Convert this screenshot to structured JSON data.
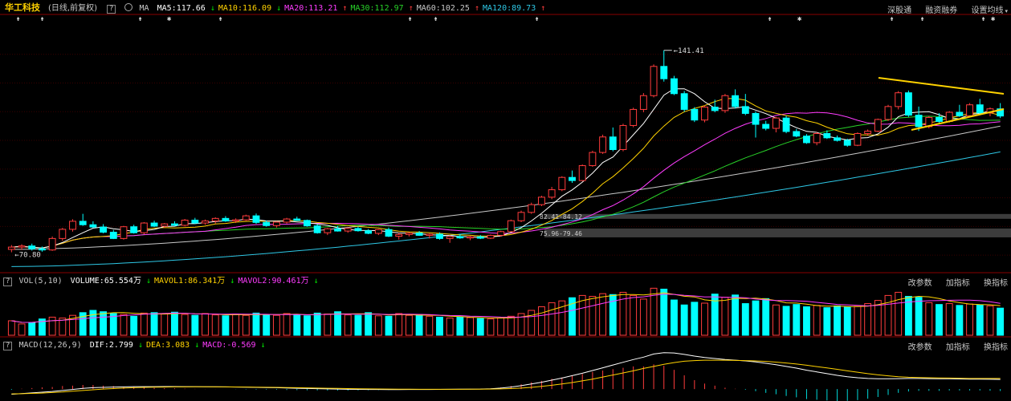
{
  "header": {
    "stock_name": "华工科技",
    "period": "(日线,前复权)",
    "help": "?",
    "ma_label": "MA",
    "ma_items": [
      {
        "text": "MA5:117.66",
        "arrow": "↓",
        "color": "#ffffff"
      },
      {
        "text": "MA10:116.09",
        "arrow": "↓",
        "color": "#ffd200"
      },
      {
        "text": "MA20:113.21",
        "arrow": "↑",
        "color": "#ff3cff"
      },
      {
        "text": "MA30:112.97",
        "arrow": "↑",
        "color": "#28d228"
      },
      {
        "text": "MA60:102.25",
        "arrow": "↑",
        "color": "#c8c8c8"
      },
      {
        "text": "MA120:89.73",
        "arrow": "↑",
        "color": "#2ec8e6"
      }
    ],
    "right_links": [
      "深股通",
      "融资融券",
      "设置均线"
    ]
  },
  "marks": [
    {
      "x": 20,
      "s": "⇟"
    },
    {
      "x": 50,
      "s": "⇟"
    },
    {
      "x": 172,
      "s": "⇟"
    },
    {
      "x": 208,
      "s": "✱"
    },
    {
      "x": 272,
      "s": "⇟"
    },
    {
      "x": 508,
      "s": "⇟"
    },
    {
      "x": 540,
      "s": "⇟"
    },
    {
      "x": 666,
      "s": "⇟"
    },
    {
      "x": 956,
      "s": "⇟"
    },
    {
      "x": 993,
      "s": "✱"
    },
    {
      "x": 1108,
      "s": "⇟"
    },
    {
      "x": 1146,
      "s": "⇟"
    },
    {
      "x": 1222,
      "s": "⇟"
    },
    {
      "x": 1234,
      "s": "✱"
    }
  ],
  "annotations": {
    "high": "141.41",
    "low": "70.80",
    "band_upper": "82.41-84.12",
    "band_lower": "75.96-79.46"
  },
  "vol_panel": {
    "help": "?",
    "name": "VOL(5,10)",
    "items": [
      {
        "text": "VOLUME:65.554万",
        "arrow": "↓",
        "color": "#ffffff"
      },
      {
        "text": "MAVOL1:86.341万",
        "arrow": "↓",
        "color": "#ffd200"
      },
      {
        "text": "MAVOL2:90.461万",
        "arrow": "↓",
        "color": "#ff3cff"
      }
    ],
    "links": [
      "改参数",
      "加指标",
      "换指标"
    ]
  },
  "macd_panel": {
    "help": "?",
    "name": "MACD(12,26,9)",
    "items": [
      {
        "text": "DIF:2.799",
        "arrow": "↓",
        "color": "#ffffff"
      },
      {
        "text": "DEA:3.083",
        "arrow": "↓",
        "color": "#ffd200"
      },
      {
        "text": "MACD:-0.569",
        "arrow": "↓",
        "color": "#ff3cff"
      }
    ],
    "links": [
      "改参数",
      "加指标",
      "换指标"
    ]
  },
  "colors": {
    "up": "#ff3c3c",
    "down": "#00ffff",
    "ma5": "#ffffff",
    "ma10": "#ffd200",
    "ma20": "#ff3cff",
    "ma30": "#28d228",
    "ma60": "#c8c8c8",
    "ma120": "#2ec8e6",
    "trendline": "#ffd200"
  },
  "chart_data": {
    "type": "candlestick",
    "ylim": [
      65,
      150
    ],
    "ohlc": [
      [
        72,
        73.5,
        71,
        72.8
      ],
      [
        72.8,
        73.8,
        71.8,
        73.2
      ],
      [
        73.2,
        74,
        71.6,
        72.2
      ],
      [
        72.2,
        73,
        71.2,
        71.8
      ],
      [
        71.8,
        76.5,
        71.5,
        75.8
      ],
      [
        75.8,
        79.5,
        75,
        79
      ],
      [
        79,
        82.5,
        78.2,
        81.8
      ],
      [
        81.8,
        84.4,
        80.2,
        80.6
      ],
      [
        80.6,
        81.8,
        79.5,
        79.8
      ],
      [
        79.8,
        80.8,
        77.6,
        78
      ],
      [
        78,
        78.8,
        75.6,
        75.8
      ],
      [
        75.8,
        80.2,
        75.4,
        79.9
      ],
      [
        79.9,
        80.6,
        77.5,
        77.8
      ],
      [
        77.8,
        81.5,
        77.3,
        81.2
      ],
      [
        81.2,
        82,
        79.8,
        80.1
      ],
      [
        80.1,
        81.2,
        79.5,
        80.9
      ],
      [
        80.9,
        81.8,
        80.1,
        80.4
      ],
      [
        80.4,
        82.6,
        80,
        82.2
      ],
      [
        82.2,
        83,
        80.9,
        81.2
      ],
      [
        81.2,
        82.4,
        80.6,
        81.9
      ],
      [
        81.9,
        83.2,
        81,
        82.8
      ],
      [
        82.8,
        83.6,
        81.6,
        81.9
      ],
      [
        81.9,
        82.8,
        81.2,
        82.3
      ],
      [
        82.3,
        84.1,
        82,
        83.7
      ],
      [
        83.7,
        84.5,
        80.9,
        81.4
      ],
      [
        81.4,
        82.1,
        79.9,
        80.3
      ],
      [
        80.3,
        81.8,
        79.6,
        81.5
      ],
      [
        81.5,
        83,
        81,
        82.6
      ],
      [
        82.6,
        83.4,
        81.9,
        82.1
      ],
      [
        82.1,
        82.4,
        79.9,
        80.2
      ],
      [
        80.2,
        80.8,
        77.5,
        77.8
      ],
      [
        77.8,
        79.5,
        77,
        79.2
      ],
      [
        79.2,
        80.2,
        78.2,
        78.4
      ],
      [
        78.4,
        79.6,
        77.8,
        79.3
      ],
      [
        79.3,
        80,
        78.2,
        78.5
      ],
      [
        78.5,
        79.1,
        77.3,
        77.6
      ],
      [
        77.6,
        79.1,
        77,
        78.9
      ],
      [
        78.9,
        79.6,
        76.3,
        76.6
      ],
      [
        76.6,
        77.8,
        75.4,
        77.2
      ],
      [
        77.2,
        78,
        76.5,
        77.7
      ],
      [
        77.7,
        78.4,
        76.7,
        76.9
      ],
      [
        76.9,
        77.6,
        75.8,
        77.3
      ],
      [
        77.3,
        77.9,
        75.4,
        75.8
      ],
      [
        75.8,
        76.9,
        74.3,
        76.5
      ],
      [
        76.5,
        77.3,
        75.7,
        76
      ],
      [
        76,
        76.8,
        75.2,
        76.4
      ],
      [
        76.4,
        77,
        75.6,
        75.9
      ],
      [
        75.9,
        77.2,
        75.6,
        76.9
      ],
      [
        76.9,
        78.5,
        76.5,
        78.2
      ],
      [
        78.2,
        82.4,
        78,
        82
      ],
      [
        82,
        85.5,
        81.5,
        84.9
      ],
      [
        84.9,
        88.3,
        84.4,
        87.6
      ],
      [
        87.6,
        90.7,
        87.1,
        90.2
      ],
      [
        90.2,
        93.8,
        89.5,
        92.8
      ],
      [
        92.8,
        97.5,
        92.3,
        97.1
      ],
      [
        97.1,
        99.5,
        95.2,
        96
      ],
      [
        96,
        101.6,
        95.8,
        101.2
      ],
      [
        101.2,
        106.4,
        100.8,
        105.8
      ],
      [
        105.8,
        112,
        105.3,
        111.2
      ],
      [
        111.2,
        114.5,
        106.2,
        106.8
      ],
      [
        106.8,
        115.8,
        106.2,
        115.2
      ],
      [
        115.2,
        121.4,
        114.6,
        120.8
      ],
      [
        120.8,
        126.5,
        119.8,
        125.6
      ],
      [
        125.6,
        136.5,
        125,
        135.8
      ],
      [
        135.8,
        141.4,
        130.5,
        131.5
      ],
      [
        131.5,
        132.5,
        125.8,
        126.3
      ],
      [
        126.3,
        127.2,
        120,
        120.8
      ],
      [
        120.8,
        121.6,
        116.4,
        117.1
      ],
      [
        117.1,
        122.2,
        116.3,
        121.6
      ],
      [
        121.6,
        124.2,
        119.8,
        120.4
      ],
      [
        120.4,
        126.2,
        119.6,
        125.6
      ],
      [
        125.6,
        127.8,
        121.1,
        121.8
      ],
      [
        121.8,
        126.2,
        118.8,
        119.4
      ],
      [
        119.4,
        120.1,
        111,
        115.6
      ],
      [
        115.6,
        116.8,
        113.5,
        114.2
      ],
      [
        114.2,
        118.2,
        112.8,
        117.8
      ],
      [
        117.8,
        118.6,
        112.5,
        113.1
      ],
      [
        113.1,
        114,
        111.1,
        111.5
      ],
      [
        111.5,
        112.2,
        108.8,
        109.2
      ],
      [
        109.2,
        112.9,
        108.3,
        112.4
      ],
      [
        112.4,
        113.5,
        110.5,
        110.9
      ],
      [
        110.9,
        111.7,
        109.6,
        110
      ],
      [
        110,
        110.6,
        107.8,
        108.3
      ],
      [
        108.3,
        112.8,
        108,
        112.4
      ],
      [
        112.4,
        113.8,
        111.6,
        113.2
      ],
      [
        113.2,
        117.6,
        112.9,
        117.3
      ],
      [
        117.3,
        122.4,
        116.8,
        121.8
      ],
      [
        121.8,
        127.2,
        120.8,
        126.6
      ],
      [
        126.6,
        127.4,
        118.2,
        118.8
      ],
      [
        118.8,
        121.8,
        113.3,
        114.8
      ],
      [
        114.8,
        118.5,
        114.2,
        118
      ],
      [
        118,
        119.5,
        116.1,
        116.6
      ],
      [
        116.6,
        120.2,
        116.2,
        119.8
      ],
      [
        119.8,
        122.4,
        118.2,
        118.6
      ],
      [
        118.6,
        123,
        118.2,
        122.4
      ],
      [
        122.4,
        124.5,
        118.8,
        119.6
      ],
      [
        119.6,
        121.5,
        118.4,
        121
      ],
      [
        121,
        123,
        117.8,
        118.5
      ]
    ],
    "volume": [
      32,
      25,
      28,
      36,
      40,
      38,
      44,
      50,
      55,
      52,
      48,
      46,
      42,
      49,
      50,
      47,
      51,
      46,
      44,
      48,
      45,
      43,
      47,
      44,
      49,
      46,
      44,
      48,
      45,
      43,
      49,
      47,
      52,
      45,
      44,
      50,
      43,
      42,
      48,
      44,
      46,
      42,
      40,
      38,
      41,
      39,
      37,
      36,
      38,
      42,
      48,
      55,
      63,
      72,
      76,
      83,
      88,
      86,
      92,
      90,
      95,
      88,
      80,
      104,
      102,
      78,
      67,
      73,
      71,
      91,
      84,
      89,
      70,
      76,
      81,
      67,
      64,
      68,
      63,
      66,
      61,
      65,
      62,
      64,
      70,
      77,
      88,
      95,
      86,
      84,
      72,
      68,
      70,
      66,
      69,
      67,
      65,
      60
    ],
    "macd_dif": [
      -1.5,
      -1.3,
      -1.1,
      -0.9,
      -0.7,
      -0.4,
      -0.1,
      0.2,
      0.4,
      0.5,
      0.6,
      0.65,
      0.7,
      0.7,
      0.72,
      0.73,
      0.74,
      0.72,
      0.7,
      0.68,
      0.66,
      0.64,
      0.6,
      0.55,
      0.5,
      0.45,
      0.4,
      0.32,
      0.25,
      0.18,
      0.12,
      0.05,
      0,
      -0.05,
      -0.08,
      -0.1,
      -0.11,
      -0.12,
      -0.12,
      -0.11,
      -0.1,
      -0.1,
      -0.08,
      -0.06,
      -0.04,
      -0.02,
      0,
      0.1,
      0.3,
      0.6,
      1,
      1.5,
      2,
      2.6,
      3.2,
      3.9,
      4.6,
      5.4,
      6.2,
      7,
      7.8,
      8.6,
      9.3,
      10.2,
      10.6,
      10.5,
      10.1,
      9.6,
      9.2,
      8.9,
      8.6,
      8.4,
      8.2,
      7.9,
      7.5,
      7.1,
      6.6,
      6.1,
      5.5,
      5,
      4.5,
      4,
      3.6,
      3.3,
      3.1,
      3,
      3,
      3.05,
      3.1,
      3.1,
      3.05,
      3,
      3,
      2.95,
      2.9,
      2.9,
      2.85,
      2.8
    ],
    "macd_dea": [
      -1.4,
      -1.35,
      -1.25,
      -1.15,
      -1,
      -0.85,
      -0.6,
      -0.4,
      -0.2,
      0,
      0.15,
      0.3,
      0.4,
      0.5,
      0.55,
      0.6,
      0.63,
      0.65,
      0.66,
      0.66,
      0.65,
      0.64,
      0.62,
      0.6,
      0.57,
      0.53,
      0.49,
      0.45,
      0.4,
      0.35,
      0.3,
      0.25,
      0.2,
      0.15,
      0.1,
      0.06,
      0.03,
      0,
      -0.02,
      -0.04,
      -0.05,
      -0.06,
      -0.06,
      -0.06,
      -0.05,
      -0.04,
      -0.03,
      0,
      0.05,
      0.15,
      0.3,
      0.5,
      0.8,
      1.1,
      1.5,
      1.9,
      2.4,
      2.9,
      3.5,
      4.1,
      4.7,
      5.3,
      6,
      6.6,
      7.2,
      7.7,
      8.1,
      8.3,
      8.4,
      8.4,
      8.4,
      8.35,
      8.3,
      8.2,
      8.05,
      7.85,
      7.6,
      7.3,
      6.95,
      6.55,
      6.15,
      5.75,
      5.3,
      4.9,
      4.5,
      4.15,
      3.85,
      3.6,
      3.45,
      3.35,
      3.3,
      3.25,
      3.2,
      3.15,
      3.1,
      3.1,
      3.09,
      3.08
    ]
  }
}
